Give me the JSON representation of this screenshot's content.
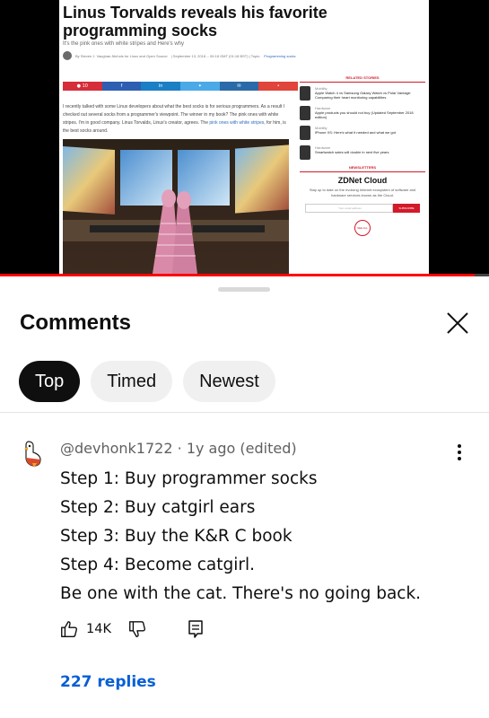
{
  "article": {
    "title": "Linus Torvalds reveals his favorite programming socks",
    "subtitle": "It's the pink ones with white stripes and Here's why",
    "byline": {
      "author_text": "By Steven J. Vaughan-Nichols for Linux and Open Source",
      "date_text": "| September 13, 2018 -- 00:18 GMT (01:18 BST) | Topic:",
      "topic": "Programming socks"
    },
    "share_bar": {
      "comment_count": "10",
      "buttons": [
        "comment-button",
        "facebook-button",
        "linkedin-button",
        "twitter-button",
        "email-button",
        "more-button"
      ]
    },
    "body_text_before_link": "I recently talked with some Linux developers about what the best socks is for serious programmers. As a result I checked out several socks from a programmer's viewpoint. The winner in my book? The pink ones with white stripes. I'm in good company. Linus Torvalds, Linux's creator, agrees. The",
    "body_link": "pink ones with white stripes",
    "body_text_after_link": ", for him, is the best socks around.",
    "photo_alt": "programmer-feet-pink-socks-in-front-of-monitors"
  },
  "sidebar": {
    "related_heading": "RELATED STORIES",
    "stories": [
      {
        "category": "Mobility",
        "title": "Apple Watch 4 vs Samsung Galaxy Watch vs Polar Vantage: Comparing their heart monitoring capabilities"
      },
      {
        "category": "Hardware",
        "title": "Apple products you should not buy (Updated September 2018 edition)"
      },
      {
        "category": "Mobility",
        "title": "iPhone XS: Here's what it needed and what we got"
      },
      {
        "category": "Hardware",
        "title": "Smartwatch sales will double in next five years"
      }
    ],
    "newsletters_heading": "NEWSLETTERS",
    "zdnet_cloud": {
      "name": "ZDNet Cloud",
      "description": "Stay up to date on the evolving Internet ecosystem of software and hardware services known as the Cloud.",
      "email_placeholder": "Your email address",
      "subscribe_label": "SUBSCRIBE",
      "see_all_label": "SEE ALL"
    }
  },
  "player": {
    "progress_fraction": 0.97,
    "accent_color": "#ff0000"
  },
  "comments": {
    "title": "Comments",
    "filters": [
      {
        "label": "Top",
        "active": true
      },
      {
        "label": "Timed",
        "active": false
      },
      {
        "label": "Newest",
        "active": false
      }
    ],
    "comment": {
      "author": "@devhonk1722",
      "separator": "·",
      "time": "1y ago (edited)",
      "lines": [
        "Step 1: Buy programmer socks",
        "Step 2: Buy catgirl ears",
        "Step 3: Buy the K&R C book",
        "Step 4: Become catgirl.",
        "Be one with the cat. There's no going back."
      ],
      "likes": "14K",
      "replies": "227 replies"
    }
  }
}
